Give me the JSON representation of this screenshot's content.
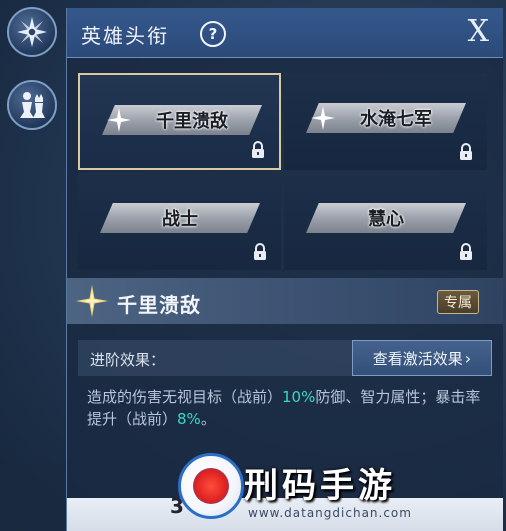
{
  "header": {
    "title": "英雄头衔",
    "help_glyph": "?",
    "close_glyph": "X"
  },
  "titles": [
    {
      "label": "千里溃敌",
      "selected": true,
      "locked": true,
      "icon": "star-icon"
    },
    {
      "label": "水淹七军",
      "selected": false,
      "locked": true,
      "icon": "star-icon"
    },
    {
      "label": "战士",
      "selected": false,
      "locked": true,
      "icon": null
    },
    {
      "label": "慧心",
      "selected": false,
      "locked": true,
      "icon": null
    }
  ],
  "detail": {
    "title": "千里溃敌",
    "badge": "专属",
    "effect_label": "进阶效果：",
    "view_button": "查看激活效果",
    "view_chevron": "›",
    "desc_part1": "造成的伤害无视目标（战前）",
    "desc_value1": "10%",
    "desc_part2": "防御、智力属性；暴击率提升（战前）",
    "desc_value2": "8%",
    "desc_end": "。"
  },
  "bottom": {
    "partial_text": "3"
  },
  "watermark": {
    "title": "刑码手游",
    "url": "www.datangdichan.com"
  },
  "colors": {
    "highlight": "#38d9c2",
    "header_bg": "#35588c",
    "selected_border": "#d9c9a2"
  }
}
